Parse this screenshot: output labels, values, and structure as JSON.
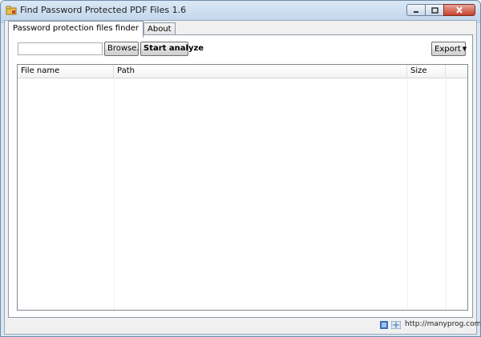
{
  "window": {
    "title": "Find Password Protected PDF Files 1.6",
    "icon": "folder-icon"
  },
  "tabs": [
    {
      "label": "Password protection files finder",
      "active": true
    },
    {
      "label": "About",
      "active": false
    }
  ],
  "toolbar": {
    "path_value": "",
    "browse_label": "Browse...",
    "analyze_label": "Start analyze",
    "export_label": "Export"
  },
  "table": {
    "columns": [
      "File name",
      "Path",
      "Size"
    ],
    "rows": []
  },
  "status": {
    "link_text": "http://manyprog.com"
  },
  "colors": {
    "title_bar": "#c3d7ec",
    "close_button": "#c6402c",
    "panel": "#ffffff",
    "dialog_bg": "#f0f0f0"
  }
}
